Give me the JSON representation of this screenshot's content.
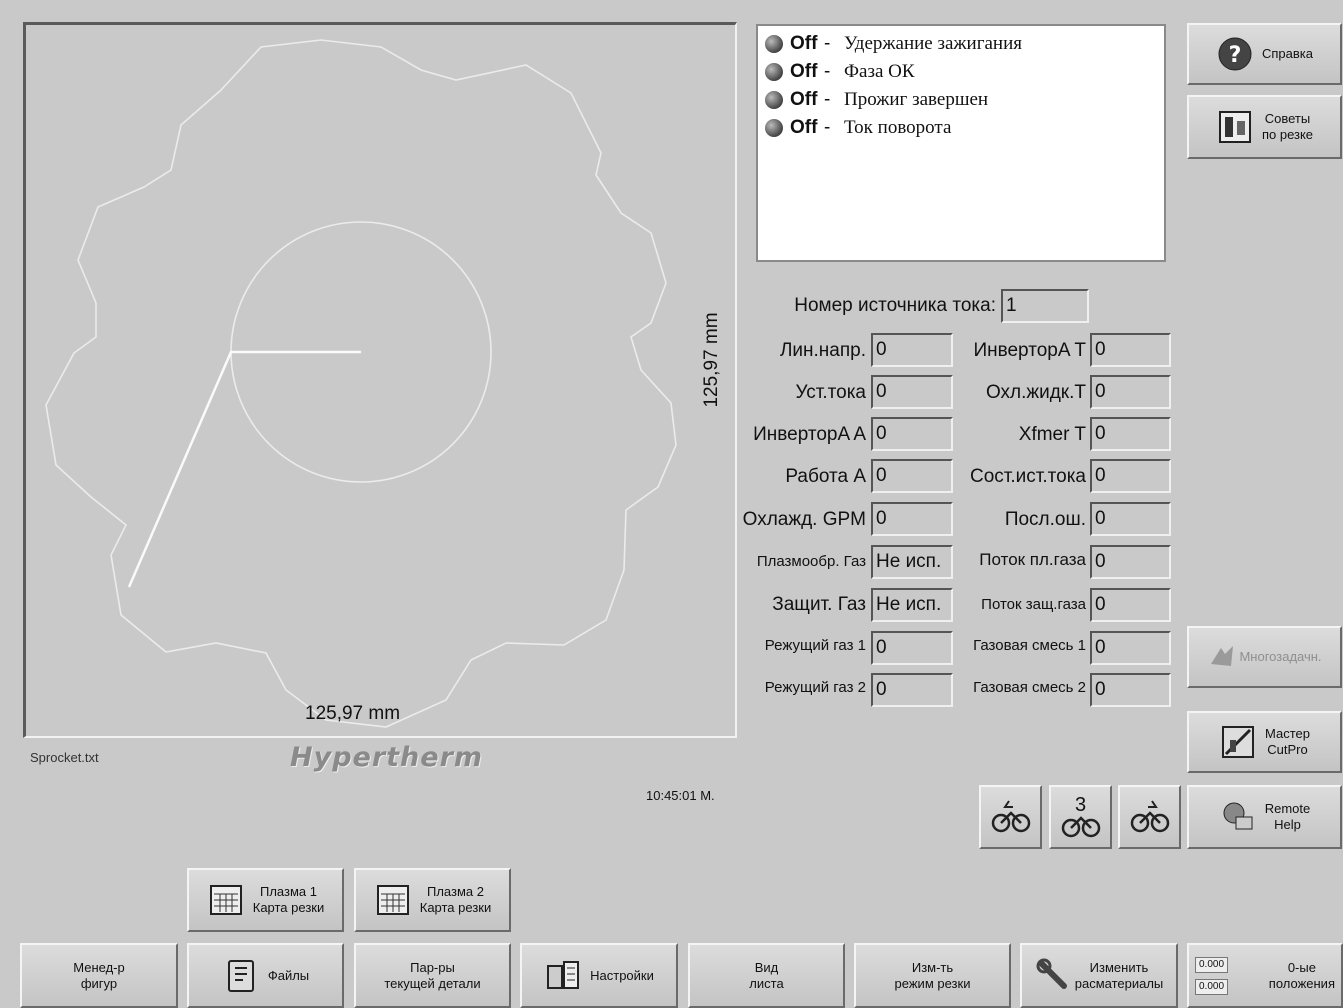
{
  "preview": {
    "width_label": "125,97 mm",
    "height_label": "125,97 mm",
    "file_name": "Sprocket.txt",
    "logo": "Hypertherm",
    "clock": "10:45:01 М."
  },
  "status_list": [
    {
      "state": "Off",
      "label": "Удержание зажигания"
    },
    {
      "state": "Off",
      "label": "Фаза ОК"
    },
    {
      "state": "Off",
      "label": "Прожиг завершен"
    },
    {
      "state": "Off",
      "label": "Ток поворота"
    }
  ],
  "power_source": {
    "label": "Номер источника тока:",
    "value": "1"
  },
  "left_fields": [
    {
      "label": "Лин.напр.",
      "value": "0"
    },
    {
      "label": "Уст.тока",
      "value": "0"
    },
    {
      "label": "ИнверторA A",
      "value": "0"
    },
    {
      "label": "Работа А",
      "value": "0"
    },
    {
      "label": "Охлажд. GPM",
      "value": "0"
    },
    {
      "label": "Плазмообр. Газ",
      "value": "Не исп."
    },
    {
      "label": "Защит. Газ",
      "value": "Не исп."
    },
    {
      "label": "Режущий газ 1",
      "value": "0"
    },
    {
      "label": "Режущий газ 2",
      "value": "0"
    }
  ],
  "right_fields": [
    {
      "label": "ИнверторA T",
      "value": "0"
    },
    {
      "label": "Охл.жидк.T",
      "value": "0"
    },
    {
      "label": "Xfmer T",
      "value": "0"
    },
    {
      "label": "Сост.ист.тока",
      "value": "0"
    },
    {
      "label": "Посл.ош.",
      "value": "0"
    },
    {
      "label": "Поток пл.газа",
      "value": "0"
    },
    {
      "label": "Поток защ.газа",
      "value": "0"
    },
    {
      "label": "Газовая смесь 1",
      "value": "0"
    },
    {
      "label": "Газовая смесь 2",
      "value": "0"
    }
  ],
  "side_buttons": {
    "help": "Справка",
    "tips": "Советы\nпо резке",
    "multitask": "Многозадачн.",
    "cutpro": "Мастер\nCutPro",
    "remote": "Remote\nHelp"
  },
  "torch_buttons": {
    "middle_number": "3"
  },
  "cut_charts": {
    "plasma1": "Плазма 1\nКарта резки",
    "plasma2": "Плазма 2\nКарта резки"
  },
  "bottom_bar": {
    "shape_manager": "Менед-р\nфигур",
    "files": "Файлы",
    "part_params": "Пар-ры\nтекущей детали",
    "settings": "Настройки",
    "sheet_view": "Вид\nлиста",
    "cut_mode": "Изм-ть\nрежим резки",
    "consumables": "Изменить\nрасматериалы",
    "zero_positions": "0-ые\nположения",
    "zero_readout_1": "0.000",
    "zero_readout_2": "0.000"
  }
}
